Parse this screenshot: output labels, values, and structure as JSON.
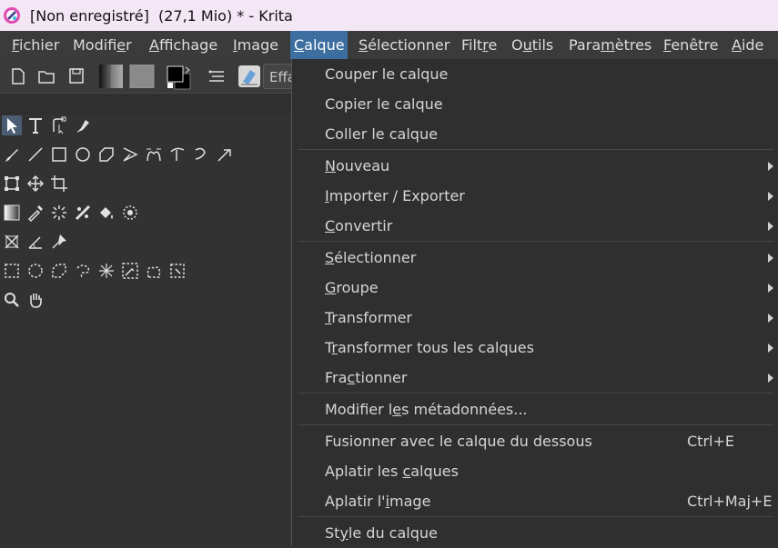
{
  "window": {
    "title": "[Non enregistré]  (27,1 Mio) * - Krita",
    "titlebar_color": "#f3e6f5"
  },
  "menubar": {
    "items": [
      {
        "pre": "",
        "u": "F",
        "post": "ichier"
      },
      {
        "pre": "Modifi",
        "u": "e",
        "post": "r"
      },
      {
        "pre": "",
        "u": "A",
        "post": "ffichage"
      },
      {
        "pre": "",
        "u": "I",
        "post": "mage"
      },
      {
        "pre": "",
        "u": "C",
        "post": "alque"
      },
      {
        "pre": "",
        "u": "S",
        "post": "électionner"
      },
      {
        "pre": "Filt",
        "u": "r",
        "post": "e"
      },
      {
        "pre": "O",
        "u": "u",
        "post": "tils"
      },
      {
        "pre": "Para",
        "u": "m",
        "post": "ètres"
      },
      {
        "pre": "",
        "u": "F",
        "post": "enêtre"
      },
      {
        "pre": "",
        "u": "A",
        "post": "ide"
      }
    ],
    "active_color": "#3d6ea0"
  },
  "toolbar": {
    "brush_preset_text": "Effa",
    "icons": [
      "new-document-icon",
      "open-document-icon",
      "save-icon",
      "gradient-swatch-icon",
      "pattern-swatch-icon",
      "fg-bg-colors-icon",
      "brush-settings-icon",
      "eraser-mode-icon"
    ]
  },
  "toolbox": {
    "rows": [
      [
        "select-shapes-icon",
        "text-icon",
        "edit-shapes-icon",
        "calligraphy-icon"
      ],
      [
        "freehand-brush-icon",
        "line-icon",
        "rectangle-icon",
        "ellipse-icon",
        "polygon-icon",
        "polyline-icon",
        "bezier-icon",
        "dynamic-brush-icon",
        "multibrush-icon",
        "assistant-brush-icon"
      ],
      [
        "transform-icon",
        "move-icon",
        "crop-icon"
      ],
      [
        "gradient-icon",
        "color-picker-icon",
        "smart-patch-icon",
        "fill-pattern-icon",
        "fill-icon",
        "enclose-fill-icon"
      ],
      [
        "assistant-tool-icon",
        "measure-icon",
        "reference-pin-icon"
      ],
      [
        "rect-select-icon",
        "ellipse-select-icon",
        "polygon-select-icon",
        "freehand-select-icon",
        "contiguous-select-icon",
        "similar-color-select-icon",
        "bezier-select-icon",
        "magnetic-select-icon"
      ],
      [
        "zoom-icon",
        "pan-icon"
      ]
    ]
  },
  "calque_menu": {
    "items": [
      {
        "pre": "Couper le calque",
        "u": "",
        "post": "",
        "shortcut": "",
        "submenu": false
      },
      {
        "pre": "Copier le calque",
        "u": "",
        "post": "",
        "shortcut": "",
        "submenu": false
      },
      {
        "pre": "Coller le calque",
        "u": "",
        "post": "",
        "shortcut": "",
        "submenu": false
      },
      {
        "pre": "",
        "u": "N",
        "post": "ouveau",
        "shortcut": "",
        "submenu": true
      },
      {
        "pre": "",
        "u": "I",
        "post": "mporter / Exporter",
        "shortcut": "",
        "submenu": true
      },
      {
        "pre": "",
        "u": "C",
        "post": "onvertir",
        "shortcut": "",
        "submenu": true
      },
      {
        "pre": "",
        "u": "S",
        "post": "électionner",
        "shortcut": "",
        "submenu": true
      },
      {
        "pre": "",
        "u": "G",
        "post": "roupe",
        "shortcut": "",
        "submenu": true
      },
      {
        "pre": "",
        "u": "T",
        "post": "ransformer",
        "shortcut": "",
        "submenu": true
      },
      {
        "pre": "T",
        "u": "r",
        "post": "ansformer tous les calques",
        "shortcut": "",
        "submenu": true
      },
      {
        "pre": "Fra",
        "u": "c",
        "post": "tionner",
        "shortcut": "",
        "submenu": true
      },
      {
        "pre": "Modifier l",
        "u": "e",
        "post": "s métadonnées...",
        "shortcut": "",
        "submenu": false
      },
      {
        "pre": "Fusionner avec le calque du dessous",
        "u": "",
        "post": "",
        "shortcut": "Ctrl+E",
        "submenu": false
      },
      {
        "pre": "Aplatir les ",
        "u": "c",
        "post": "alques",
        "shortcut": "",
        "submenu": false
      },
      {
        "pre": "Aplatir l'",
        "u": "i",
        "post": "mage",
        "shortcut": "Ctrl+Maj+E",
        "submenu": false
      },
      {
        "pre": "St",
        "u": "y",
        "post": "le du calque",
        "shortcut": "",
        "submenu": false
      }
    ]
  }
}
